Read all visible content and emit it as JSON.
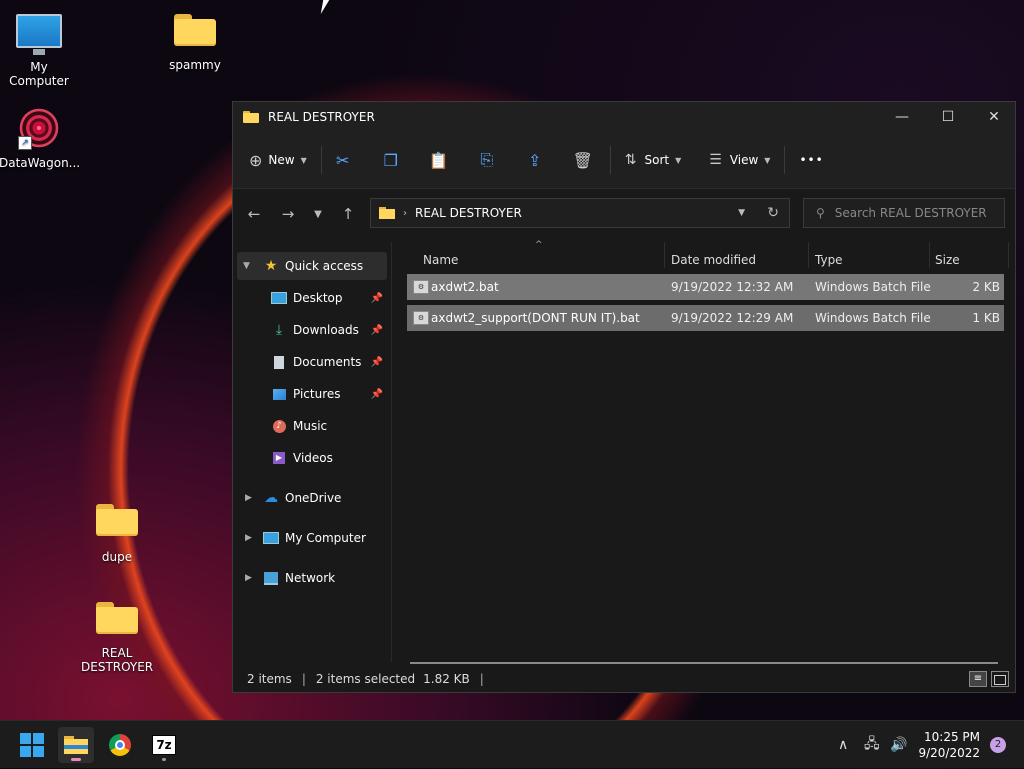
{
  "desktop": {
    "icons": [
      {
        "label": "My Computer"
      },
      {
        "label": "spammy"
      },
      {
        "label": "DataWagon..."
      },
      {
        "label": "dupe"
      },
      {
        "label": "REAL DESTROYER"
      }
    ]
  },
  "window": {
    "title": "REAL DESTROYER",
    "controls": {
      "minimize": "—",
      "maximize": "☐",
      "close": "✕"
    },
    "toolbar": {
      "new_label": "New",
      "sort_label": "Sort",
      "view_label": "View",
      "more_label": "•••"
    },
    "address": {
      "path": "REAL DESTROYER"
    },
    "search": {
      "placeholder": "Search REAL DESTROYER"
    },
    "sidebar": {
      "quick_access": "Quick access",
      "items": [
        {
          "label": "Desktop",
          "pinned": true
        },
        {
          "label": "Downloads",
          "pinned": true
        },
        {
          "label": "Documents",
          "pinned": true
        },
        {
          "label": "Pictures",
          "pinned": true
        },
        {
          "label": "Music",
          "pinned": false
        },
        {
          "label": "Videos",
          "pinned": false
        }
      ],
      "onedrive": "OneDrive",
      "mycomputer": "My Computer",
      "network": "Network"
    },
    "columns": {
      "name": "Name",
      "date": "Date modified",
      "type": "Type",
      "size": "Size"
    },
    "files": [
      {
        "name": "axdwt2.bat",
        "date": "9/19/2022 12:32 AM",
        "type": "Windows Batch File",
        "size": "2 KB"
      },
      {
        "name": "axdwt2_support(DONT RUN IT).bat",
        "date": "9/19/2022 12:29 AM",
        "type": "Windows Batch File",
        "size": "1 KB"
      }
    ],
    "status": {
      "count": "2 items",
      "selected": "2 items selected",
      "size": "1.82 KB"
    }
  },
  "taskbar": {
    "time": "10:25 PM",
    "date": "9/20/2022",
    "notification_count": "2",
    "sevenzip_label": "7z"
  },
  "colors": {
    "accent": "#5aa9ff",
    "folder": "#ffd75e",
    "selection": "#777777"
  }
}
